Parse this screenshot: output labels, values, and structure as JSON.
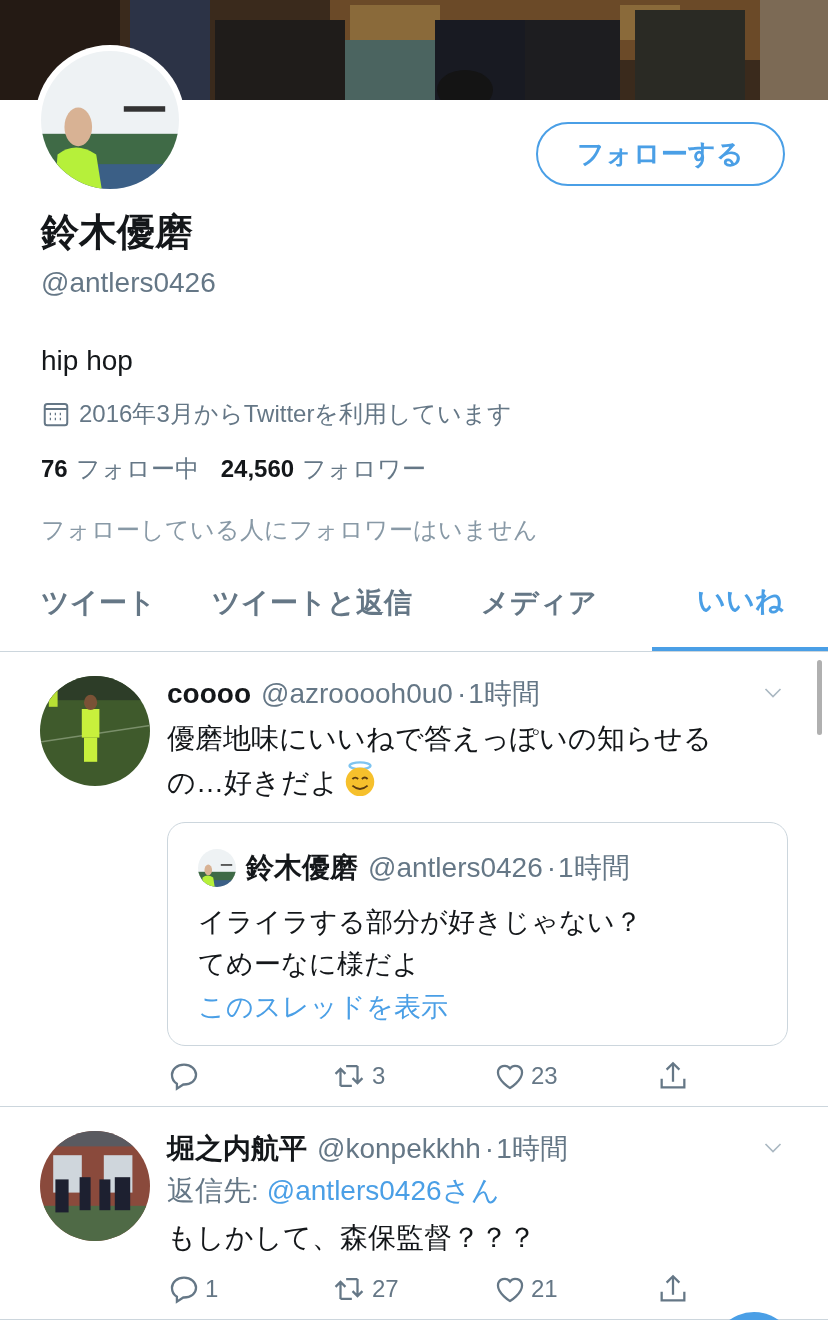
{
  "profile": {
    "name": "鈴木優磨",
    "handle": "@antlers0426",
    "bio": "hip hop",
    "joined": "2016年3月からTwitterを利用しています",
    "following_count": "76",
    "following_label": "フォロー中",
    "followers_count": "24,560",
    "followers_label": "フォロワー",
    "mutual_note": "フォローしている人にフォロワーはいません",
    "follow_button": "フォローする"
  },
  "tabs": [
    {
      "label": "ツイート",
      "selected": false
    },
    {
      "label": "ツイートと返信",
      "selected": false
    },
    {
      "label": "メディア",
      "selected": false
    },
    {
      "label": "いいね",
      "selected": true
    }
  ],
  "tweets": [
    {
      "name": "coooo",
      "handle": "@azrooooh0u0",
      "dot": "·",
      "time": "1時間",
      "text": "優磨地味にいいねで答えっぽいの知らせるの…好きだよ",
      "emoji": true,
      "quote": {
        "name": "鈴木優磨",
        "handle": "@antlers0426",
        "dot": "·",
        "time": "1時間",
        "lines": [
          "イライラする部分が好きじゃない？",
          "てめーなに様だよ"
        ],
        "link": "このスレッドを表示"
      },
      "retweets": "3",
      "likes": "23"
    },
    {
      "name": "堀之内航平",
      "handle": "@konpekkhh",
      "dot": "·",
      "time": "1時間",
      "reply_label": "返信先:",
      "reply_to": "@antlers0426さん",
      "text": "もしかして、森保監督？？？",
      "emoji": false,
      "replies": "1",
      "retweets": "27",
      "likes": "21"
    }
  ]
}
